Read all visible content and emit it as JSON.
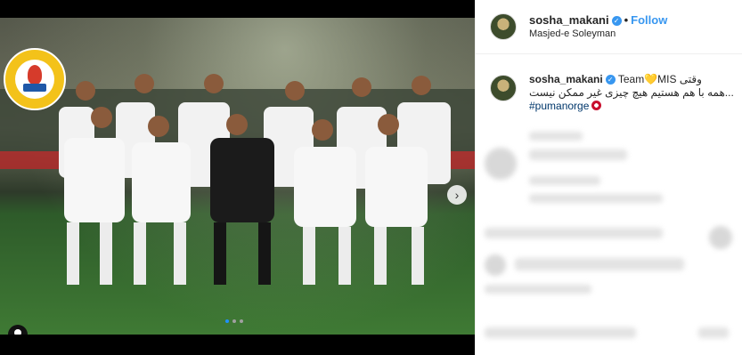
{
  "post": {
    "username": "sosha_makani",
    "follow_label": "Follow",
    "location": "Masjed-e Soleyman",
    "separator": "•",
    "verified_icon": "verified-badge-icon"
  },
  "caption": {
    "username": "sosha_makani",
    "line1_prefix": "Team",
    "line1_suffix": "MIS وقتی",
    "line2": "همه با هم هستیم هیچ چیزی غیر ممکن نیست...",
    "hashtag": "#pumanorge",
    "heart_glyph": "💛"
  },
  "carousel": {
    "total_slides": 3,
    "active_slide": 1,
    "next_icon": "chevron-right-icon",
    "tag_icon": "user-tag-icon"
  },
  "colors": {
    "accent": "#3897f0",
    "hashtag": "#00376b",
    "logo_yellow": "#f3c21a"
  }
}
